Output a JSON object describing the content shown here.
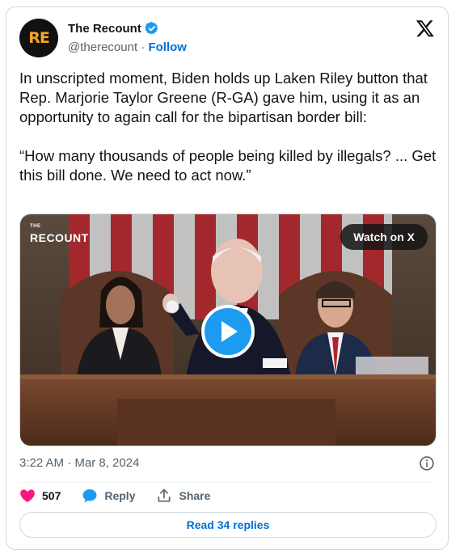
{
  "author": {
    "avatar_text": "RE",
    "name": "The Recount",
    "handle": "@therecount",
    "separator": " · ",
    "follow_label": "Follow"
  },
  "tweet": {
    "text": "In unscripted moment, Biden holds up Laken Riley button that Rep. Marjorie Taylor Greene (R-GA) gave him, using it as an opportunity to again call for the bipartisan border bill:\n\n“How many thousands of people being killed by illegals? ... Get this bill done. We need to act now.”",
    "timestamp": "3:22 AM · Mar 8, 2024"
  },
  "media": {
    "watermark_top": "THE",
    "watermark": "RECOUNT",
    "watch_label": "Watch on X"
  },
  "actions": {
    "likes": "507",
    "reply_label": "Reply",
    "share_label": "Share"
  },
  "read_replies_label": "Read 34 replies",
  "colors": {
    "link": "#006fd6",
    "verified": "#1d9bf0",
    "like": "#f91880",
    "play": "#1d9bf0",
    "text": "#0f1419",
    "muted": "#536471"
  },
  "icons": [
    "verified-badge-icon",
    "x-logo-icon",
    "play-icon",
    "info-icon",
    "heart-icon",
    "reply-bubble-icon",
    "share-icon"
  ]
}
